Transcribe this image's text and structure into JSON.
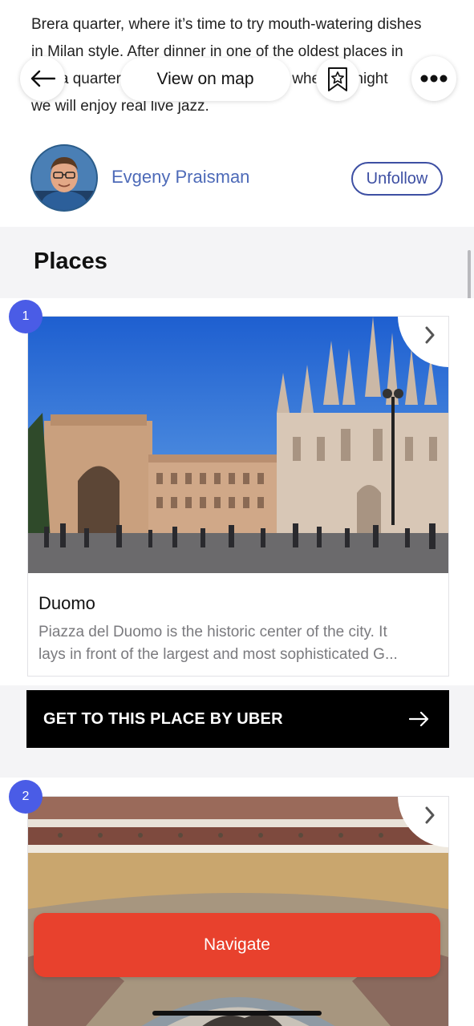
{
  "description": {
    "lines": [
      "Brera quarter, where it’s time to try mouth-watering dishes",
      "in Milan style. After dinner in one of the oldest places in",
      "Brera quarter, we will go to a jazz club where at night",
      "we will enjoy real live jazz."
    ]
  },
  "top_bar": {
    "back_icon": "arrow-left-icon",
    "map_label": "View on map",
    "bookmark_icon": "bookmark-star-icon",
    "more_icon": "more-dots-icon"
  },
  "author": {
    "name": "Evgeny Praisman",
    "follow_label": "Unfollow"
  },
  "places": {
    "title": "Places",
    "items": [
      {
        "number": "1",
        "name": "Duomo",
        "description_lines": [
          "Piazza del Duomo is the historic center of the city. It",
          "lays in front of the largest and most sophisticated G..."
        ],
        "uber_label": "GET TO THIS PLACE BY UBER"
      },
      {
        "number": "2"
      }
    ]
  },
  "navigate_label": "Navigate",
  "colors": {
    "accent_blue": "#4a5ce6",
    "link_blue": "#4d6ab8",
    "navigate_red": "#e8412d",
    "uber_black": "#000000"
  }
}
